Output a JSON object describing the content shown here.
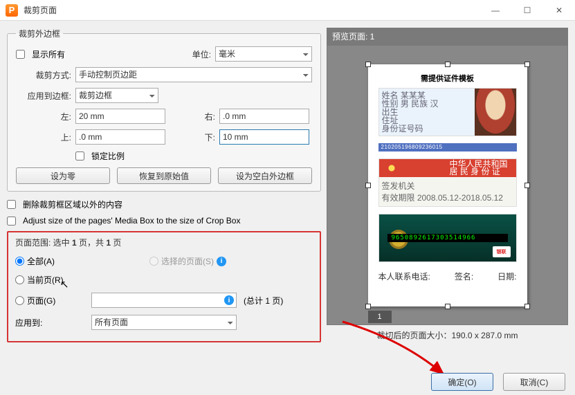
{
  "window": {
    "title": "裁剪页面"
  },
  "crop": {
    "legend": "裁剪外边框",
    "show_all": "显示所有",
    "unit_label": "单位:",
    "unit_value": "毫米",
    "method_label": "裁剪方式:",
    "method_value": "手动控制页边距",
    "apply_border_label": "应用到边框:",
    "apply_border_value": "裁剪边框",
    "left_label": "左:",
    "left_value": "20 mm",
    "right_label": "右:",
    "right_value": ".0 mm",
    "top_label": "上:",
    "top_value": ".0 mm",
    "bottom_label": "下:",
    "bottom_value": "10 mm",
    "lock_ratio": "锁定比例",
    "btn_zero": "设为零",
    "btn_reset": "恢复到原始值",
    "btn_blank": "设为空白外边框",
    "cb_delete": "删除裁剪框区域以外的内容",
    "cb_adjust": "Adjust size of the pages' Media Box to the size of Crop Box"
  },
  "range": {
    "title_a": "页面范围: 选中 ",
    "title_b": "1",
    "title_c": " 页，共 ",
    "title_d": "1",
    "title_e": " 页",
    "all": "全部(A)",
    "selected": "选择的页面(S)",
    "current": "当前页(R)",
    "pages": "页面(G)",
    "total": "(总计 1 页)",
    "apply_to_label": "应用到:",
    "apply_to_value": "所有页面"
  },
  "preview": {
    "header": "预览页面: 1",
    "doc_title": "需提供证件模板",
    "barcode": "210205196809236015",
    "card2_line1": "中华人民共和国",
    "card2_line2": "居 民 身 份 证",
    "card2_bot_a": "签发机关",
    "card2_bot_b": "有效期限  2008.05.12-2018.05.12",
    "cardnum": "9650892617303514966",
    "union": "银联",
    "contact_a": "本人联系电话:",
    "contact_b": "签名:",
    "contact_c": "日期:",
    "page_num": "1",
    "size": "裁切后的页面大小：190.0 x 287.0 mm"
  },
  "footer": {
    "ok": "确定(O)",
    "cancel": "取消(C)"
  },
  "card1": {
    "l1": "姓名 某某某",
    "l2": "性别 男   民族 汉",
    "l3": "出生",
    "l4": "住址",
    "l5": "身份证号码"
  }
}
